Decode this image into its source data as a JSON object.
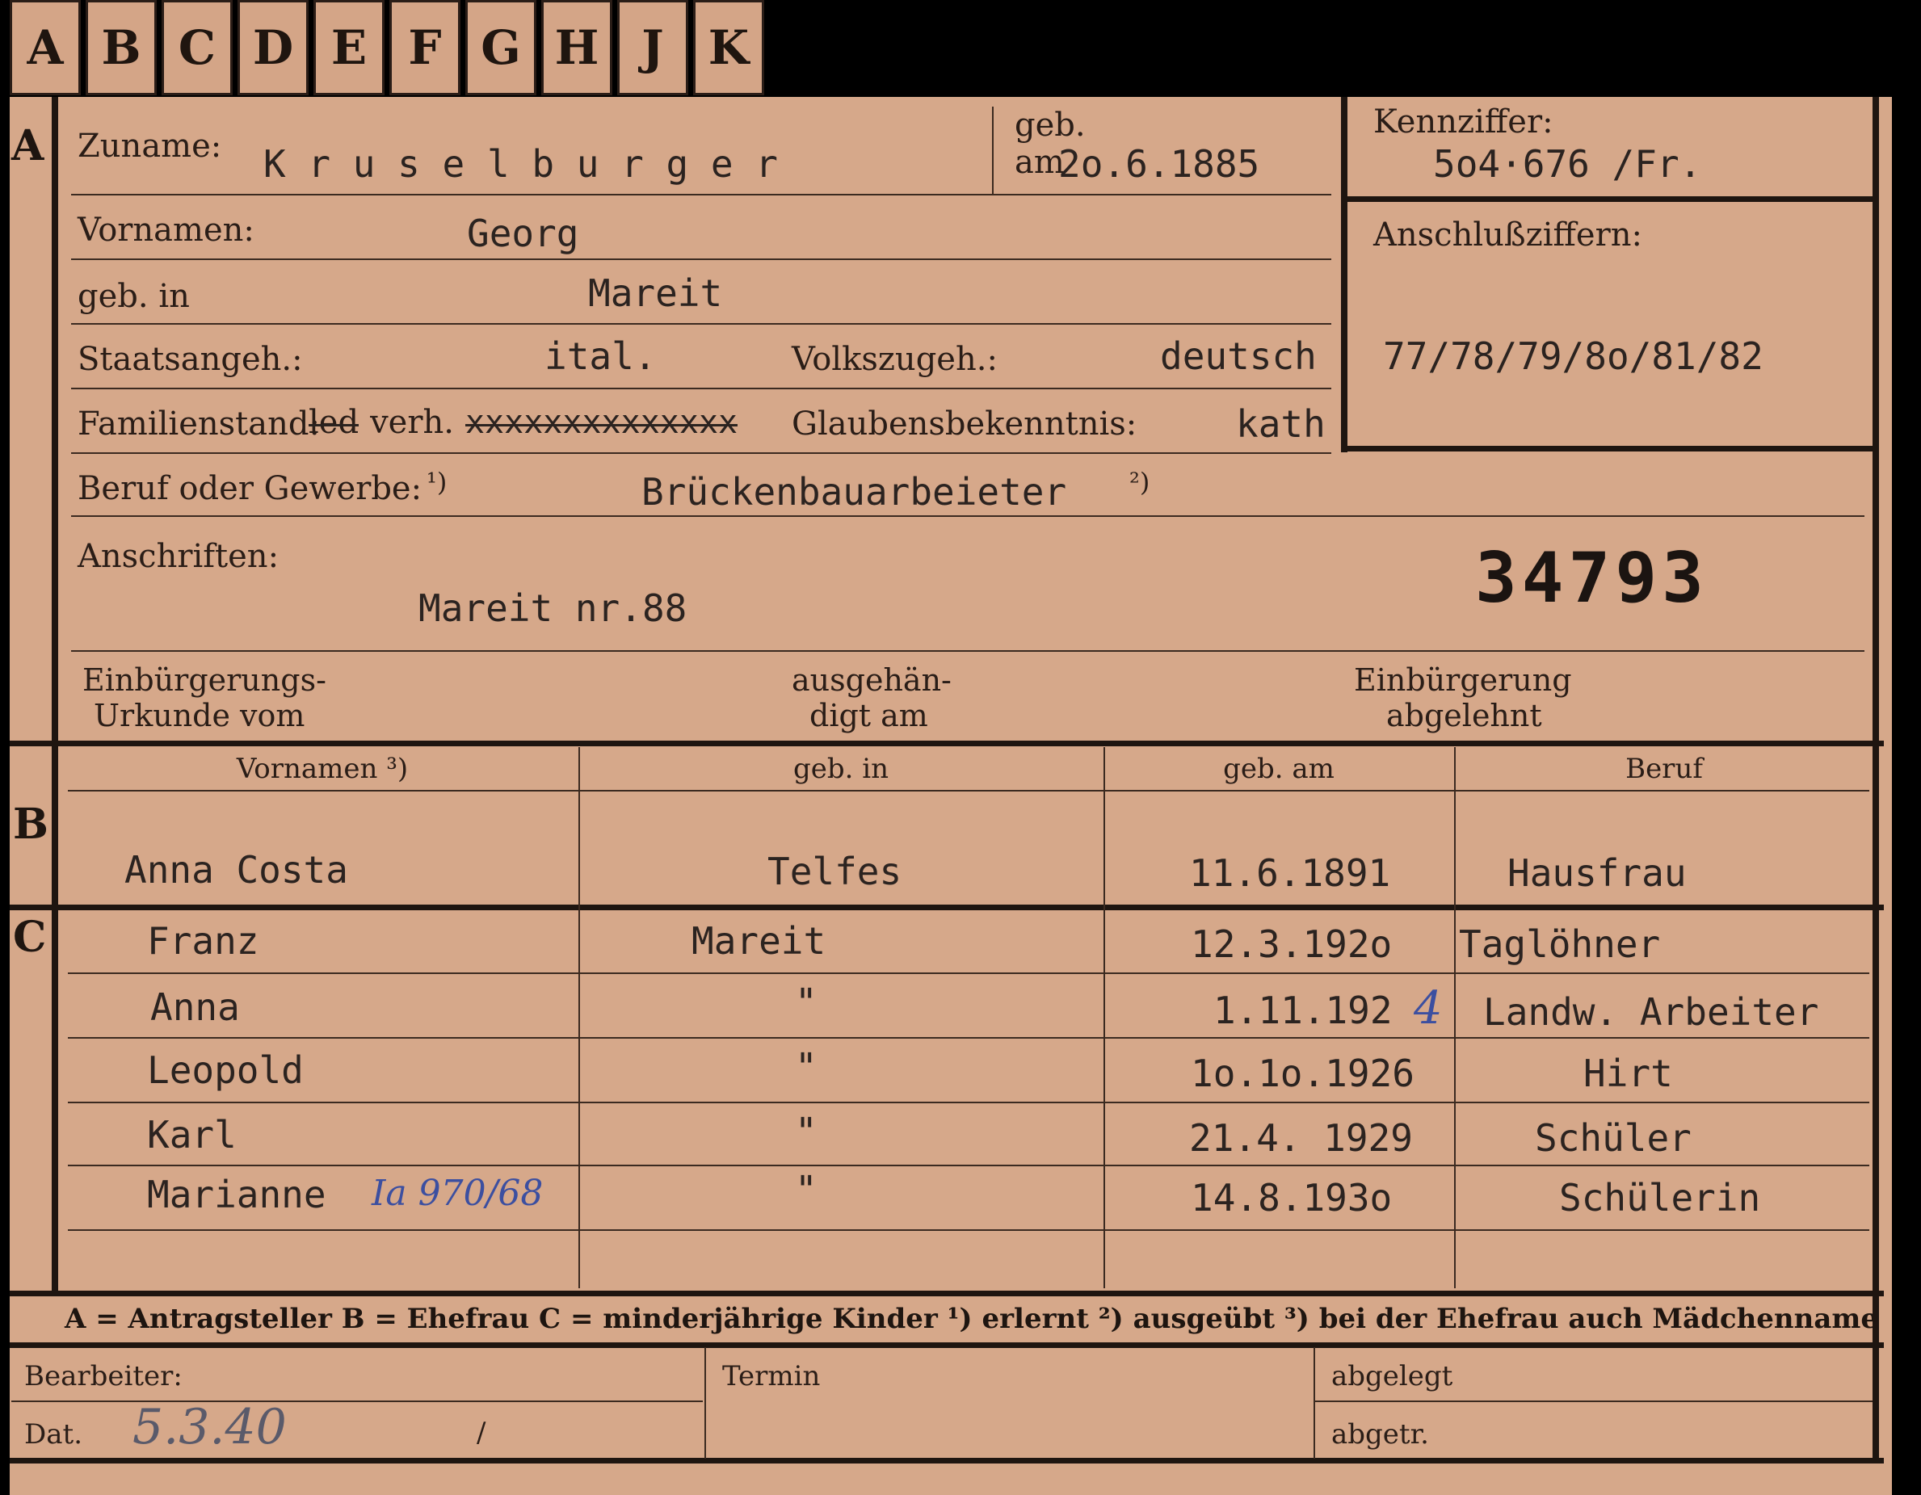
{
  "tabs": [
    "A",
    "B",
    "C",
    "D",
    "E",
    "F",
    "G",
    "H",
    "J",
    "K"
  ],
  "sections": {
    "a": "A",
    "b": "B",
    "c": "C"
  },
  "a": {
    "zuname_label": "Zuname:",
    "zuname_value": "K r u s e l b u r g e r",
    "geb_label_1": "geb.",
    "geb_label_2": "am",
    "geb_value": "2o.6.1885",
    "kennziffer_label": "Kennziffer:",
    "kennziffer_value": "5o4·676  /Fr.",
    "vornamen_label": "Vornamen:",
    "vornamen_value": "Georg",
    "anschluss_label": "Anschlußziffern:",
    "anschluss_value": "77/78/79/8o/81/82",
    "gebin_label": "geb. in",
    "gebin_value": "Mareit",
    "staats_label": "Staatsangeh.:",
    "staats_value": "ital.",
    "volks_label": "Volkszugeh.:",
    "volks_value": "deutsch",
    "familien_label": "Familienstand:",
    "familien_led": "led",
    "familien_verh": "verh.",
    "familien_struck": "xxxxxxxxxxxxxx",
    "glauben_label": "Glaubensbekenntnis:",
    "glauben_value": "kath",
    "beruf_label": "Beruf oder Gewerbe:",
    "beruf_note1": "¹)",
    "beruf_value": "Brückenbauarbeieter",
    "beruf_note2": "²)",
    "anschriften_label": "Anschriften:",
    "anschriften_value": "Mareit nr.88",
    "stamp_number": "34793",
    "einb_urkunde_1": "Einbürgerungs-",
    "einb_urkunde_2": "Urkunde vom",
    "ausgeh_1": "ausgehän-",
    "ausgeh_2": "digt am",
    "einb_abgelehnt_1": "Einbürgerung",
    "einb_abgelehnt_2": "abgelehnt"
  },
  "table": {
    "headers": [
      "Vornamen ³)",
      "geb. in",
      "geb. am",
      "Beruf"
    ],
    "wife": {
      "name": "Anna Costa",
      "place": "Telfes",
      "date": "11.6.1891",
      "job": "Hausfrau"
    },
    "children": [
      {
        "name": "Franz",
        "place": "Mareit",
        "date": "12.3.192o",
        "job": "Taglöhner"
      },
      {
        "name": "Anna",
        "place": "\"",
        "date": "1.11.192",
        "date_hand": "4",
        "job": "Landw. Arbeiter"
      },
      {
        "name": "Leopold",
        "place": "\"",
        "date": "1o.1o.1926",
        "job": "Hirt"
      },
      {
        "name": "Karl",
        "place": "\"",
        "date": "21.4. 1929",
        "job": "Schüler"
      },
      {
        "name": "Marianne",
        "name_note": "Ia 970/68",
        "place": "\"",
        "date": "14.8.193o",
        "job": "Schülerin"
      }
    ]
  },
  "legend": "A = Antragsteller   B = Ehefrau   C = minderjährige Kinder   ¹) erlernt   ²) ausgeübt   ³) bei der Ehefrau auch Mädchenname",
  "footer": {
    "bearbeiter_label": "Bearbeiter:",
    "dat_label": "Dat.",
    "dat_value": "5.3.40",
    "slash": "/",
    "termin_label": "Termin",
    "abgelegt_label": "abgelegt",
    "abgetr_label": "abgetr."
  }
}
